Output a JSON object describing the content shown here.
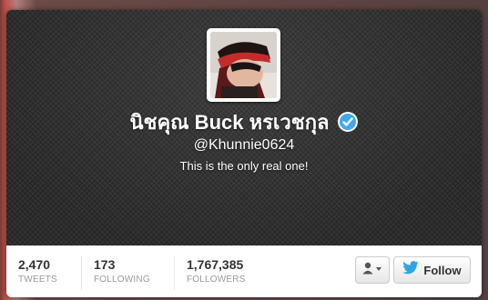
{
  "profile": {
    "display_name": "นิชคุณ Buck หรเวชกุล",
    "verified": true,
    "handle": "@Khunnie0624",
    "bio": "This is the only real one!"
  },
  "stats": [
    {
      "value": "2,470",
      "label": "TWEETS"
    },
    {
      "value": "173",
      "label": "FOLLOWING"
    },
    {
      "value": "1,767,385",
      "label": "FOLLOWERS"
    }
  ],
  "actions": {
    "user_menu_icon": "user-dropdown-icon",
    "follow_label": "Follow"
  },
  "colors": {
    "verified_blue": "#3ea9ef",
    "twitter_bird": "#2ea5e1"
  }
}
